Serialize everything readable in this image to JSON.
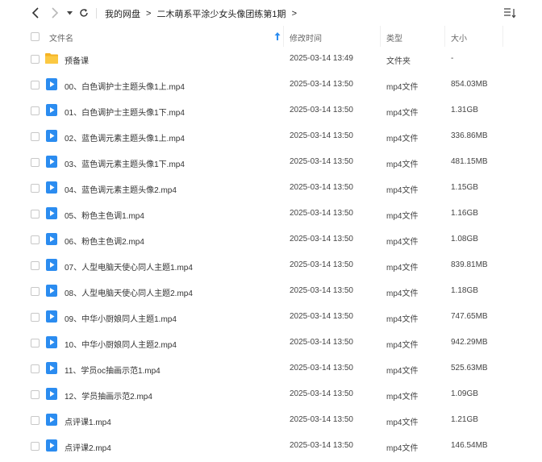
{
  "breadcrumb": {
    "items": [
      "我的网盘",
      "二木萌系平涂少女头像团练第1期"
    ],
    "separator": ">",
    "trailing": ">"
  },
  "header": {
    "name": "文件名",
    "modified": "修改时间",
    "type": "类型",
    "size": "大小"
  },
  "colors": {
    "accent": "#2b8cf0",
    "folder": "#f7b731",
    "mp4": "#2b8cf0"
  },
  "files": [
    {
      "name": "预备课",
      "date": "2025-03-14 13:49",
      "type": "文件夹",
      "size": "-",
      "icon": "folder-icon"
    },
    {
      "name": "00、白色调护士主题头像1上.mp4",
      "date": "2025-03-14 13:50",
      "type": "mp4文件",
      "size": "854.03MB",
      "icon": "video-icon"
    },
    {
      "name": "01、白色调护士主题头像1下.mp4",
      "date": "2025-03-14 13:50",
      "type": "mp4文件",
      "size": "1.31GB",
      "icon": "video-icon"
    },
    {
      "name": "02、蓝色调元素主题头像1上.mp4",
      "date": "2025-03-14 13:50",
      "type": "mp4文件",
      "size": "336.86MB",
      "icon": "video-icon"
    },
    {
      "name": "03、蓝色调元素主题头像1下.mp4",
      "date": "2025-03-14 13:50",
      "type": "mp4文件",
      "size": "481.15MB",
      "icon": "video-icon"
    },
    {
      "name": "04、蓝色调元素主题头像2.mp4",
      "date": "2025-03-14 13:50",
      "type": "mp4文件",
      "size": "1.15GB",
      "icon": "video-icon"
    },
    {
      "name": "05、粉色主色调1.mp4",
      "date": "2025-03-14 13:50",
      "type": "mp4文件",
      "size": "1.16GB",
      "icon": "video-icon"
    },
    {
      "name": "06、粉色主色调2.mp4",
      "date": "2025-03-14 13:50",
      "type": "mp4文件",
      "size": "1.08GB",
      "icon": "video-icon"
    },
    {
      "name": "07、人型电脑天使心同人主题1.mp4",
      "date": "2025-03-14 13:50",
      "type": "mp4文件",
      "size": "839.81MB",
      "icon": "video-icon"
    },
    {
      "name": "08、人型电脑天使心同人主题2.mp4",
      "date": "2025-03-14 13:50",
      "type": "mp4文件",
      "size": "1.18GB",
      "icon": "video-icon"
    },
    {
      "name": "09、中华小厨娘同人主题1.mp4",
      "date": "2025-03-14 13:50",
      "type": "mp4文件",
      "size": "747.65MB",
      "icon": "video-icon"
    },
    {
      "name": "10、中华小厨娘同人主题2.mp4",
      "date": "2025-03-14 13:50",
      "type": "mp4文件",
      "size": "942.29MB",
      "icon": "video-icon"
    },
    {
      "name": "11、学员oc抽画示范1.mp4",
      "date": "2025-03-14 13:50",
      "type": "mp4文件",
      "size": "525.63MB",
      "icon": "video-icon"
    },
    {
      "name": "12、学员抽画示范2.mp4",
      "date": "2025-03-14 13:50",
      "type": "mp4文件",
      "size": "1.09GB",
      "icon": "video-icon"
    },
    {
      "name": "点评课1.mp4",
      "date": "2025-03-14 13:50",
      "type": "mp4文件",
      "size": "1.21GB",
      "icon": "video-icon"
    },
    {
      "name": "点评课2.mp4",
      "date": "2025-03-14 13:50",
      "type": "mp4文件",
      "size": "146.54MB",
      "icon": "video-icon"
    }
  ]
}
